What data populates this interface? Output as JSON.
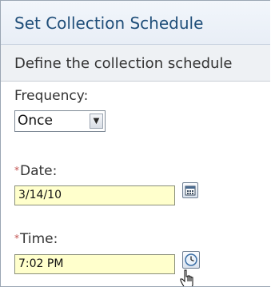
{
  "panel": {
    "title": "Set Collection Schedule",
    "subtitle": "Define the collection schedule"
  },
  "frequency": {
    "label": "Frequency:",
    "selected": "Once"
  },
  "date": {
    "required_marker": "*",
    "label": "Date:",
    "value": "3/14/10"
  },
  "time": {
    "required_marker": "*",
    "label": "Time:",
    "value": "7:02 PM"
  },
  "colors": {
    "title": "#1f4e79",
    "required": "#c0504d",
    "input_background": "#ffffcc"
  },
  "icons": {
    "dropdown": "chevron-down-icon",
    "date_picker": "calendar-icon",
    "time_picker": "clock-icon",
    "cursor": "hand-pointer-icon"
  }
}
